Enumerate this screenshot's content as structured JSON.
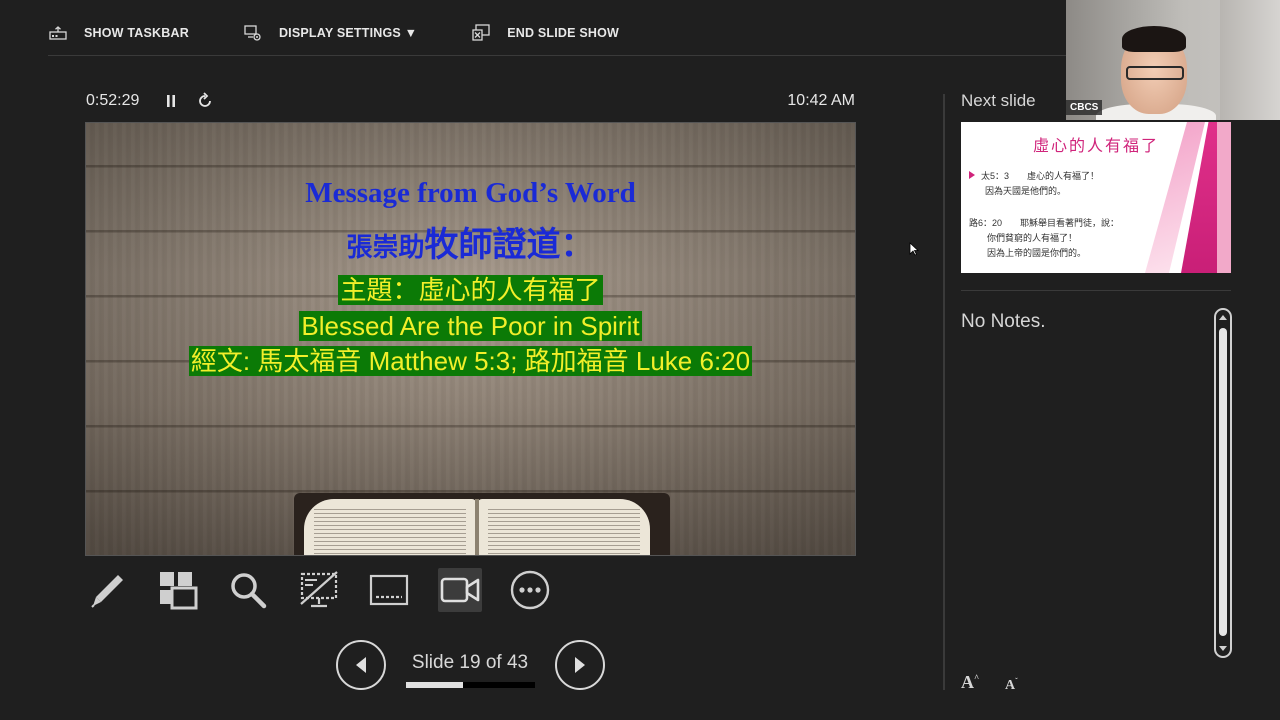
{
  "toolbar": {
    "show_taskbar": "SHOW TASKBAR",
    "display_settings": "DISPLAY SETTINGS ▼",
    "end_slide_show": "END SLIDE SHOW"
  },
  "presenter": {
    "elapsed_time": "0:52:29",
    "clock": "10:42 AM"
  },
  "current_slide": {
    "heading_en": "Message from God’s Word",
    "heading_zh_name": "張崇助",
    "heading_zh_title": "牧師證道：",
    "topic_zh": "主題：虛心的人有福了",
    "topic_en": "Blessed Are the Poor in Spirit",
    "scripture": "經文: 馬太福音 Matthew 5:3; 路加福音 Luke 6:20"
  },
  "tools": [
    {
      "name": "pen-icon"
    },
    {
      "name": "see-all-slides-icon"
    },
    {
      "name": "zoom-icon"
    },
    {
      "name": "black-screen-icon"
    },
    {
      "name": "subtitles-icon"
    },
    {
      "name": "camera-icon"
    },
    {
      "name": "more-options-icon"
    }
  ],
  "navigation": {
    "slide_label": "Slide 19 of 43",
    "progress_fraction": 0.44
  },
  "next_slide": {
    "label": "Next slide",
    "title": "虛心的人有福了",
    "line1": "太5：3　　虛心的人有福了！",
    "line2": "因為天國是他們的。",
    "line3": "路6：20　　耶穌舉目看著門徒，說：",
    "line4": "你們貧窮的人有福了！",
    "line5": "因為上帝的國是你們的。"
  },
  "notes": {
    "text": "No Notes."
  },
  "webcam": {
    "name_tag": "CBCS"
  }
}
